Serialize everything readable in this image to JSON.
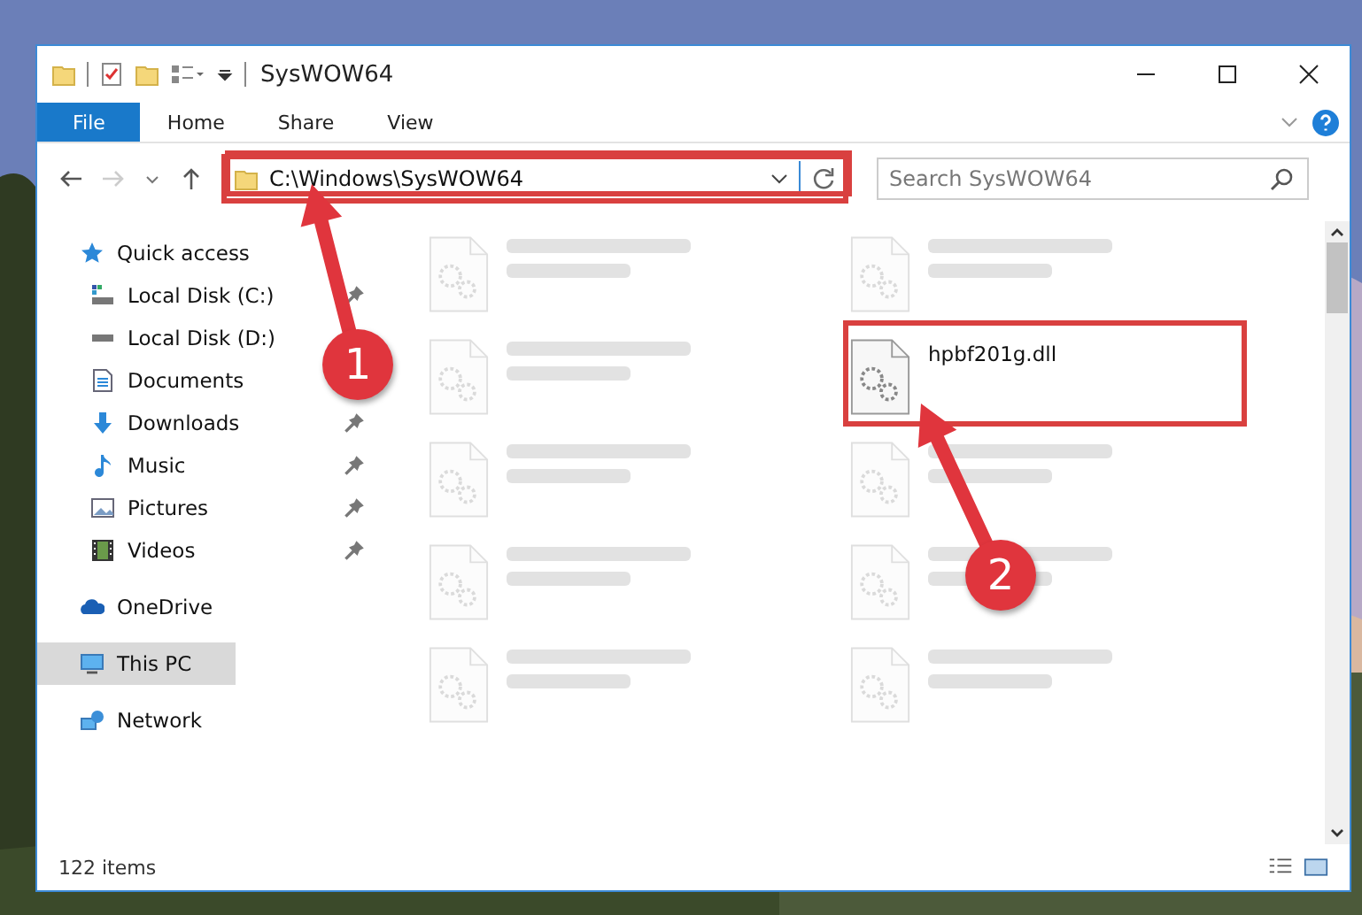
{
  "window": {
    "title": "SysWOW64"
  },
  "ribbon_tabs": [
    {
      "label": "File",
      "selected": true
    },
    {
      "label": "Home",
      "selected": false
    },
    {
      "label": "Share",
      "selected": false
    },
    {
      "label": "View",
      "selected": false
    }
  ],
  "address": {
    "path": "C:\\Windows\\SysWOW64"
  },
  "search": {
    "placeholder": "Search SysWOW64"
  },
  "navigation": [
    {
      "label": "Quick access",
      "selected": false,
      "children": [
        {
          "label": "Local Disk (C:)",
          "pinned": true,
          "selected": false
        },
        {
          "label": "Local Disk (D:)",
          "selected": false
        },
        {
          "label": "Documents",
          "selected": false
        },
        {
          "label": "Downloads",
          "pinned": true,
          "selected": false
        },
        {
          "label": "Music",
          "pinned": true,
          "selected": false
        },
        {
          "label": "Pictures",
          "pinned": true,
          "selected": false
        },
        {
          "label": "Videos",
          "pinned": true,
          "selected": false
        }
      ]
    },
    {
      "label": "OneDrive",
      "selected": false
    },
    {
      "label": "This PC",
      "selected": true
    },
    {
      "label": "Network",
      "selected": false
    }
  ],
  "files": [
    {
      "dimmed": true
    },
    {
      "dimmed": true
    },
    {
      "dimmed": true
    },
    {
      "name": "hpbf201g.dll",
      "dimmed": false
    },
    {
      "dimmed": true
    },
    {
      "dimmed": true
    },
    {
      "dimmed": true
    },
    {
      "dimmed": true
    },
    {
      "dimmed": true
    },
    {
      "dimmed": true
    }
  ],
  "status_bar": {
    "count": "122 items"
  },
  "annotations": [
    {
      "number": "1"
    },
    {
      "number": "2"
    }
  ]
}
